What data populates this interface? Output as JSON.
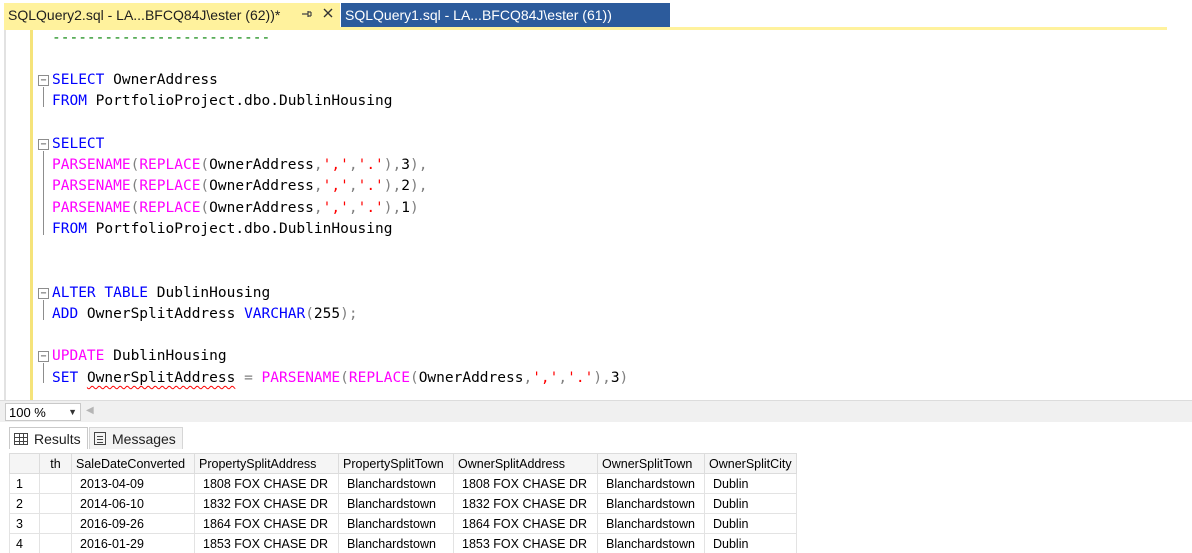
{
  "tabs": [
    {
      "label": "SQLQuery2.sql - LA...BFCQ84J\\ester (62))*",
      "active": true
    },
    {
      "label": "SQLQuery1.sql - LA...BFCQ84J\\ester (61))",
      "active": false
    }
  ],
  "icons": {
    "pin": "pin-icon",
    "close": "close-icon",
    "results": "grid-icon",
    "messages": "message-icon"
  },
  "colors": {
    "active_tab": "#fff29d",
    "inactive_tab": "#2c5b9c",
    "keyword": "#0000ff",
    "function": "#ff00ff",
    "string": "#ff0000"
  },
  "editor": {
    "divider": "-------------------------",
    "q1_select": "SELECT",
    "q1_col": " OwnerAddress",
    "q1_from": "FROM",
    "q1_table": " PortfolioProject.dbo.DublinHousing",
    "q2_select": "SELECT",
    "q2_parsename": "PARSENAME",
    "q2_replace": "REPLACE",
    "q2_arg": "OwnerAddress",
    "q2_comma_str": "','",
    "q2_dot_str": "'.'",
    "q2_idx1": "3",
    "q2_idx2": "2",
    "q2_idx3": "1",
    "q2_from": "FROM",
    "q2_table": " PortfolioProject.dbo.DublinHousing",
    "q3_alter": "ALTER TABLE",
    "q3_table": " DublinHousing",
    "q3_add": "ADD",
    "q3_col": " OwnerSplitAddress ",
    "q3_type": "VARCHAR",
    "q3_len": "255",
    "q4_update": "UPDATE",
    "q4_table": " DublinHousing",
    "q4_set": "SET",
    "q4_col": "OwnerSplitAddress",
    "q4_eq": " = ",
    "q4_parsename": "PARSENAME",
    "q4_replace": "REPLACE",
    "q4_arg": "OwnerAddress",
    "q4_idx": "3"
  },
  "zoom": {
    "value": "100 %"
  },
  "results_panel": {
    "results_tab": "Results",
    "messages_tab": "Messages",
    "columns": [
      "th",
      "SaleDateConverted",
      "PropertySplitAddress",
      "PropertySplitTown",
      "OwnerSplitAddress",
      "OwnerSplitTown",
      "OwnerSplitCity"
    ],
    "rows": [
      {
        "num": "1",
        "cells": [
          "2013-04-09",
          "1808  FOX CHASE DR",
          "Blanchardstown",
          "1808  FOX CHASE DR",
          "Blanchardstown",
          "Dublin"
        ]
      },
      {
        "num": "2",
        "cells": [
          "2014-06-10",
          "1832  FOX CHASE DR",
          "Blanchardstown",
          "1832  FOX CHASE DR",
          "Blanchardstown",
          "Dublin"
        ]
      },
      {
        "num": "3",
        "cells": [
          "2016-09-26",
          "1864 FOX CHASE  DR",
          "Blanchardstown",
          "1864  FOX CHASE DR",
          "Blanchardstown",
          "Dublin"
        ]
      },
      {
        "num": "4",
        "cells": [
          "2016-01-29",
          "1853  FOX CHASE DR",
          "Blanchardstown",
          "1853  FOX CHASE DR",
          "Blanchardstown",
          "Dublin"
        ]
      }
    ]
  }
}
